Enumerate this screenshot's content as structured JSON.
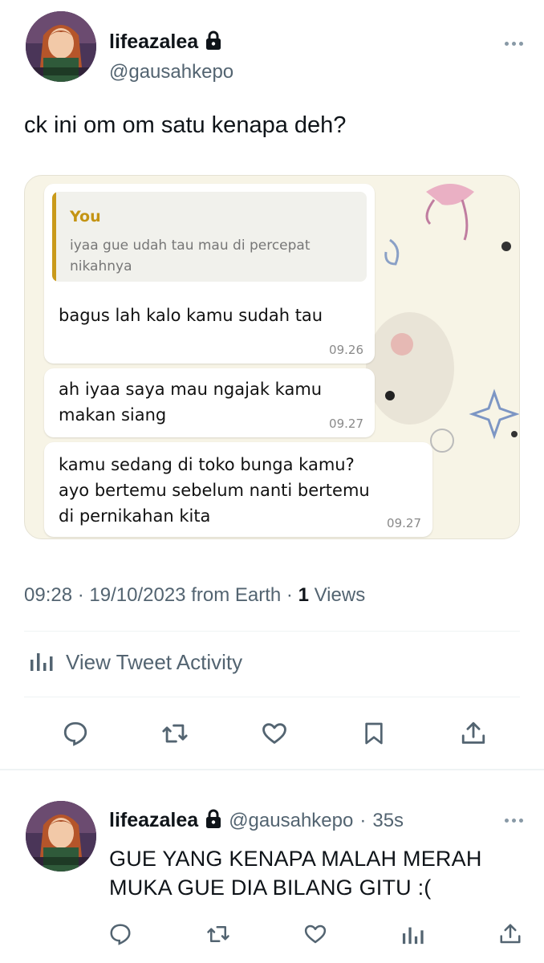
{
  "tweet": {
    "author": {
      "display_name": "lifeazalea",
      "handle": "@gausahkepo",
      "protected_icon": "lock-icon"
    },
    "text": "ck ini om om satu kenapa deh?",
    "media": {
      "quote": {
        "sender": "You",
        "text": "iyaa gue udah tau mau di percepat nikahnya"
      },
      "messages": [
        {
          "text": "bagus lah kalo kamu sudah tau",
          "time": "09.26"
        },
        {
          "text": "ah iyaa saya mau ngajak kamu\nmakan siang",
          "time": "09.27"
        },
        {
          "text": "kamu sedang di toko bunga kamu?\nayo bertemu sebelum nanti bertemu\ndi pernikahan kita",
          "time": "09.27"
        }
      ]
    },
    "meta": {
      "time": "09:28",
      "date": "19/10/2023",
      "source": "from Earth",
      "views_count": "1",
      "views_label": "Views"
    },
    "activity_label": "View Tweet Activity",
    "actions": [
      "reply-icon",
      "retweet-icon",
      "like-icon",
      "bookmark-icon",
      "share-icon"
    ]
  },
  "reply": {
    "author": {
      "display_name": "lifeazalea",
      "handle": "@gausahkepo",
      "age": "35s"
    },
    "text": "GUE YANG KENAPA MALAH MERAH MUKA GUE DIA BILANG GITU :(",
    "actions": [
      "reply-icon",
      "retweet-icon",
      "like-icon",
      "analytics-icon",
      "share-icon"
    ]
  },
  "colors": {
    "text": "#0f1419",
    "secondary": "#536471",
    "divider": "#eff3f4",
    "quote_accent": "#c99a1a"
  }
}
